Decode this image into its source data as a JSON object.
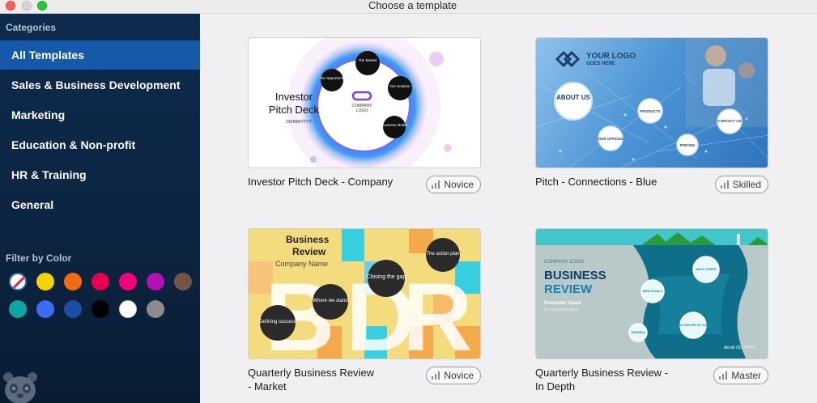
{
  "window": {
    "title": "Choose a template"
  },
  "sidebar": {
    "categories_heading": "Categories",
    "categories": [
      {
        "label": "All Templates",
        "active": true
      },
      {
        "label": "Sales & Business Development",
        "active": false
      },
      {
        "label": "Marketing",
        "active": false
      },
      {
        "label": "Education & Non-profit",
        "active": false
      },
      {
        "label": "HR & Training",
        "active": false
      },
      {
        "label": "General",
        "active": false
      }
    ],
    "filter_heading": "Filter by Color",
    "colors": [
      "none",
      "#f3d400",
      "#f26a12",
      "#e4004f",
      "#f4007c",
      "#b50fb8",
      "#735447",
      "#0aa7a4",
      "#3a6df4",
      "#1a4fa5",
      "#000000",
      "#ffffff",
      "#8c8c8c"
    ]
  },
  "templates": [
    {
      "name": "Investor Pitch Deck - Company",
      "level": "Novice",
      "thumb": {
        "title_line1": "Investor",
        "title_line2": "Pitch Deck",
        "date": "DD/MM/YYYY",
        "logo_line1": "COMPANY",
        "logo_line2": "LOGO",
        "nodes": [
          "The Market",
          "The Opportunity",
          "Our Solution",
          "Business Model"
        ]
      }
    },
    {
      "name": "Pitch - Connections - Blue",
      "level": "Skilled",
      "thumb": {
        "logo_line1": "YOUR LOGO",
        "logo_line2": "GOES HERE",
        "about": "ABOUT US",
        "nodes": [
          "PRODUCTS",
          "CONTACT US",
          "OUR OFFICES",
          "PRICING"
        ]
      }
    },
    {
      "name": "Quarterly Business Review - Market",
      "name_line1": "Quarterly Business Review",
      "name_line2": "- Market",
      "level": "Novice",
      "thumb": {
        "title_line1": "Business",
        "title_line2": "Review",
        "subtitle": "Company Name",
        "nodes": [
          "The action plan",
          "Closing the gap",
          "Where we stand",
          "Defining success"
        ]
      }
    },
    {
      "name": "Quarterly Business Review - In Depth",
      "name_line1": "Quarterly Business Review -",
      "name_line2": "In Depth",
      "level": "Master",
      "thumb": {
        "logo": "COMPANY LOGO",
        "title_line1": "BUSINESS",
        "title_line2": "REVIEW",
        "presenter": "Presenter Name",
        "company": "for Company name",
        "date": "Month DD, YYYY",
        "nodes": [
          "NEXT STEPS",
          "NEW GOALS",
          "HOW FAR WE'VE COME",
          "AGENDA"
        ]
      }
    }
  ]
}
